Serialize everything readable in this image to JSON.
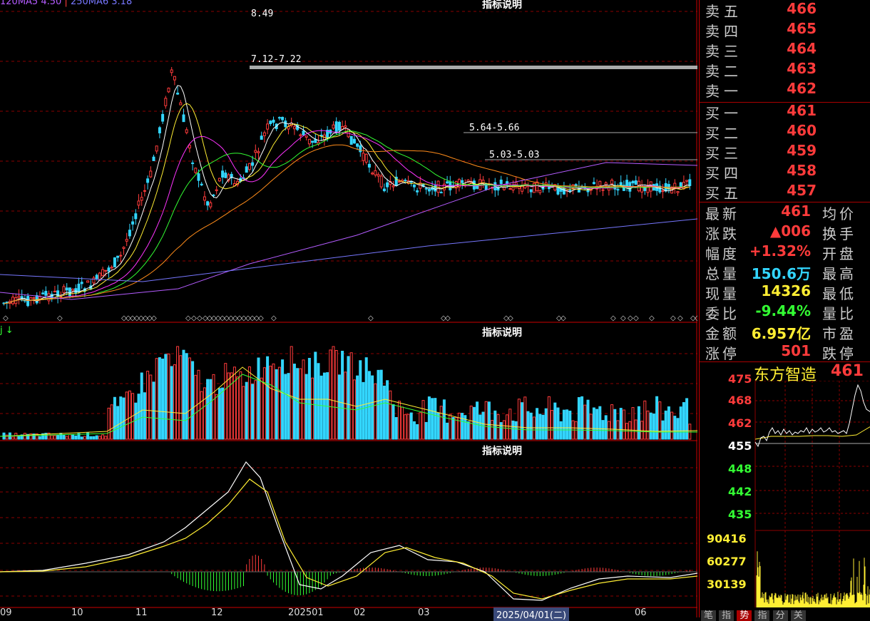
{
  "ma_legend": {
    "ma120": "120MA5 4.50",
    "ma250": "250MA6 3.18"
  },
  "panels": {
    "main_label": "指标说明",
    "volume_label": "指标说明",
    "macd_label": "指标说明",
    "vol_arrow": "j ↓"
  },
  "price_annotations": {
    "high": "8.49",
    "range1": "7.12-7.22",
    "range2": "5.64-5.66",
    "range3": "5.03-5.03"
  },
  "xaxis": [
    "09",
    "10",
    "11",
    "12",
    "202501",
    "02",
    "03",
    "2025/04/01(二)",
    "06"
  ],
  "orderbook": {
    "sell": [
      {
        "label": "卖五",
        "price": "466"
      },
      {
        "label": "卖四",
        "price": "465"
      },
      {
        "label": "卖三",
        "price": "464"
      },
      {
        "label": "卖二",
        "price": "463"
      },
      {
        "label": "卖一",
        "price": "462"
      }
    ],
    "buy": [
      {
        "label": "买一",
        "price": "461"
      },
      {
        "label": "买二",
        "price": "460"
      },
      {
        "label": "买三",
        "price": "459"
      },
      {
        "label": "买四",
        "price": "458"
      },
      {
        "label": "买五",
        "price": "457"
      }
    ]
  },
  "stats": [
    {
      "key": "最新",
      "value": "461",
      "color": "#ff3b3b",
      "key2": "均价"
    },
    {
      "key": "涨跌",
      "value": "▲006",
      "color": "#ff3b3b",
      "key2": "换手"
    },
    {
      "key": "幅度",
      "value": "+1.32%",
      "color": "#ff3b3b",
      "key2": "开盘"
    },
    {
      "key": "总量",
      "value": "150.6万",
      "color": "#33d6ff",
      "key2": "最高"
    },
    {
      "key": "现量",
      "value": "14326",
      "color": "#ffee33",
      "key2": "最低"
    },
    {
      "key": "委比",
      "value": "-9.44%",
      "color": "#33ff33",
      "key2": "量比"
    },
    {
      "key": "金额",
      "value": "6.957亿",
      "color": "#ffee33",
      "key2": "市盈"
    },
    {
      "key": "涨停",
      "value": "501",
      "color": "#ff3b3b",
      "key2": "跌停"
    }
  ],
  "mini": {
    "title": "东方智造",
    "price": "461",
    "y_prices": [
      "475",
      "468",
      "462",
      "455",
      "448",
      "442",
      "435"
    ],
    "y_vol": [
      "90416",
      "60277",
      "30139"
    ]
  },
  "tabs": [
    "笔",
    "指",
    "势",
    "指",
    "分",
    "关"
  ],
  "colors": {
    "up": "#ff3b3b",
    "down": "#33d6ff",
    "grid": "#8b0000",
    "ma5": "#ffffff",
    "ma10": "#ffee33",
    "ma20": "#ff33ff",
    "ma30": "#33ff33",
    "ma60": "#ff8c1a",
    "ma120": "#b45cff",
    "ma250": "#7777ff"
  }
}
